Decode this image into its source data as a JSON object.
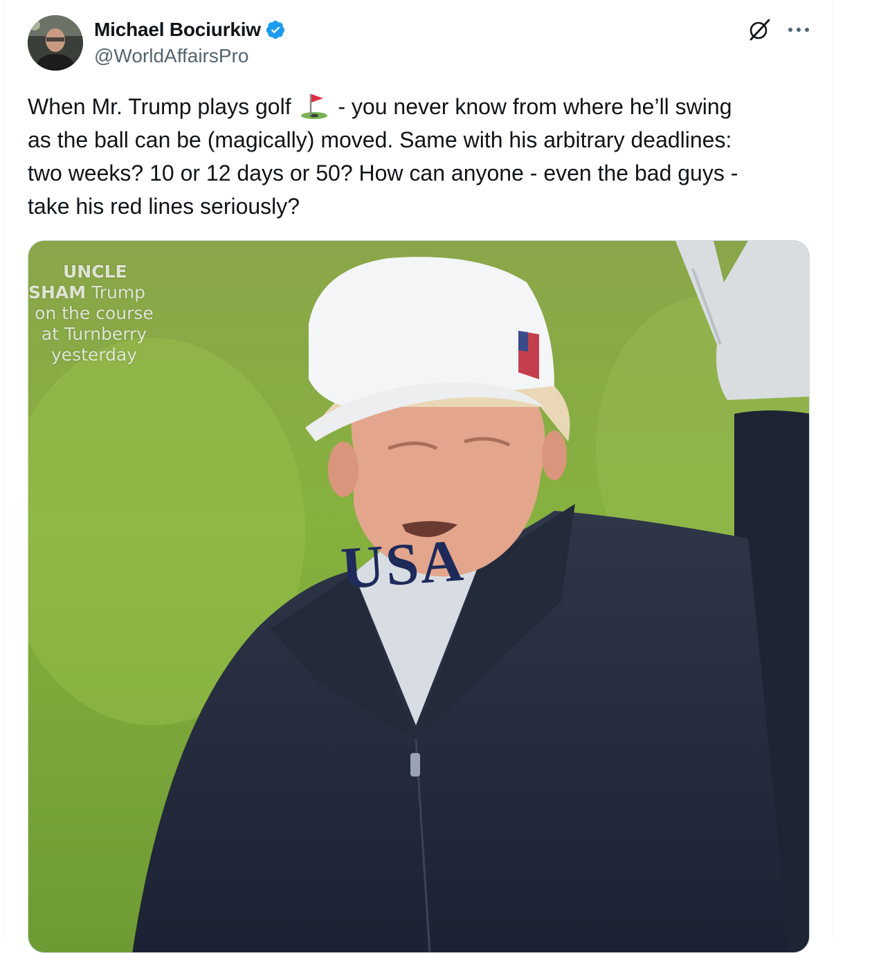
{
  "author": {
    "name": "Michael Bociurkiw",
    "handle": "@WorldAffairsPro",
    "verified": true,
    "verified_color": "#1d9bf0"
  },
  "header_icons": {
    "grok": "grok-icon",
    "more": "more-icon"
  },
  "tweet": {
    "text_before_emoji": "When Mr. Trump plays golf ",
    "emoji": "flag-in-hole",
    "text_after_emoji": " - you never know from where he’ll swing\nas the ball can be (magically) moved. Same with his arbitrary deadlines:\ntwo weeks? 10 or 12 days or 50? How can anyone - even the bad guys -\ntake his red lines seriously?"
  },
  "media": {
    "caption_bold_1": "UNCLE",
    "caption_bold_2": "SHAM",
    "caption_rest_1": " Trump",
    "caption_line_3": "on the course",
    "caption_line_4": "at Turnberry",
    "caption_line_5": "yesterday",
    "hat_text": "USA"
  },
  "colors": {
    "text": "#0f1419",
    "secondary": "#536471",
    "border": "#cfd9de"
  }
}
